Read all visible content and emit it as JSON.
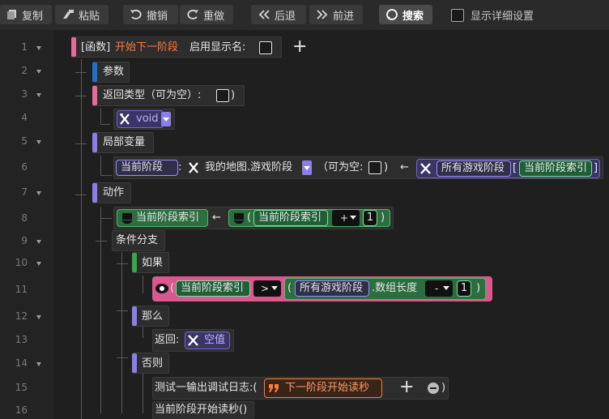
{
  "toolbar": {
    "copy": "复制",
    "paste": "粘贴",
    "undo": "撤销",
    "redo": "重做",
    "back": "后退",
    "forward": "前进",
    "search": "搜索",
    "show_detail": "显示详细设置"
  },
  "lines": [
    "1",
    "2",
    "3",
    "4",
    "5",
    "6",
    "7",
    "8",
    "9",
    "10",
    "11",
    "12",
    "13",
    "14",
    "15",
    "16"
  ],
  "func": {
    "prefix": "[函数]",
    "name": "开始下一阶段",
    "show_name_label": "启用显示名:",
    "add": "+"
  },
  "params": {
    "label": "参数"
  },
  "return_type": {
    "label": "返回类型（可为空）:",
    "close": ")",
    "type_name": "void"
  },
  "locals": {
    "label": "局部变量",
    "var_name": "当前阶段",
    "colon": ":",
    "var_type": "我的地图.游戏阶段",
    "nullable_label": "（可为空:",
    "nullable_close": ")",
    "arrow": "←",
    "source": "所有游戏阶段",
    "bracket_open": "[",
    "index_var": "当前阶段索引",
    "bracket_close": "]"
  },
  "actions": {
    "label": "动作",
    "assign_target": "当前阶段索引",
    "arrow": "←",
    "paren_open": "(",
    "operand": "当前阶段索引",
    "op": "+",
    "value": "1",
    "paren_close": ")"
  },
  "cond": {
    "label": "条件分支",
    "if_label": "如果",
    "lhs": "当前阶段索引",
    "cmp": ">",
    "array": "所有游戏阶段",
    "length_label": ".数组长度",
    "minus": "-",
    "value": "1",
    "then_label": "那么",
    "return_label": "返回:",
    "null_value": "空值",
    "else_label": "否则",
    "log_label": "测试一输出调试日志:(",
    "log_string": "下一阶段开始读秒",
    "log_add": "+",
    "log_close": ")",
    "call": "当前阶段开始读秒()"
  },
  "colors": {
    "function": "#e56b9c",
    "params": "#1f6fcf",
    "section": "#8a7fe8",
    "condition": "#39a64a",
    "string": "#ff7a3d"
  }
}
